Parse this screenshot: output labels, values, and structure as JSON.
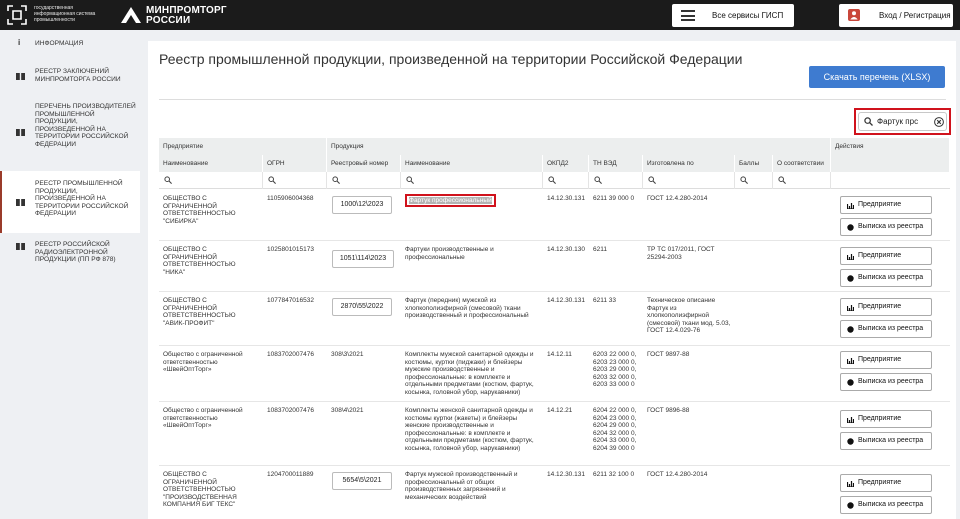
{
  "header": {
    "gisp_text": "государственная информационная система промышленности",
    "ministry_text": "МИНПРОМТОРГ РОССИИ",
    "services_label": "Все сервисы ГИСП",
    "login_label": "Вход / Регистрация"
  },
  "sidebar": {
    "items": [
      {
        "label": "Информация"
      },
      {
        "label": "Реестр заключений Минпромторга России"
      },
      {
        "label": "Перечень производителей промышленной продукции, произведенной на территории Российской Федерации"
      },
      {
        "label": "Реестр промышленной продукции, произведенной на территории Российской Федерации"
      },
      {
        "label": "Реестр российской радиоэлектронной продукции (ПП РФ 878)"
      }
    ]
  },
  "main": {
    "title": "Реестр промышленной продукции, произведенной на территории Российской Федерации",
    "download_label": "Скачать перечень (XLSX)",
    "search": {
      "value": "Фартук прс"
    }
  },
  "table": {
    "group_headers": {
      "enterprise": "Предприятие",
      "product": "Продукция",
      "actions": "Действия"
    },
    "columns": [
      "Наименование",
      "ОГРН",
      "Реестровый номер",
      "Наименование",
      "ОКПД2",
      "ТН ВЭД",
      "Изготовлена по",
      "Баллы",
      "О соответствии"
    ],
    "buttons": {
      "enterprise": "Предприятие",
      "extract": "Выписка из реестра"
    },
    "rows": [
      {
        "company": "ОБЩЕСТВО С ОГРАНИЧЕННОЙ ОТВЕТСТВЕННОСТЬЮ \"СИБИРКА\"",
        "ogrn": "1105906004368",
        "reg": "1000\\12\\2023",
        "product": "Фартук профессиональный",
        "okpd": "14.12.30.131",
        "tnved": "6211 39 000 0",
        "standard": "ГОСТ 12.4.280-2014"
      },
      {
        "company": "ОБЩЕСТВО С ОГРАНИЧЕННОЙ ОТВЕТСТВЕННОСТЬЮ \"НИКА\"",
        "ogrn": "1025801015173",
        "reg": "1051\\114\\2023",
        "product": "Фартуки производственные и профессиональные",
        "okpd": "14.12.30.130",
        "tnved": "6211",
        "standard": "ТР ТС 017/2011, ГОСТ 25294-2003"
      },
      {
        "company": "ОБЩЕСТВО С ОГРАНИЧЕННОЙ ОТВЕТСТВЕННОСТЬЮ \"АВИК-ПРОФИТ\"",
        "ogrn": "1077847016532",
        "reg": "2870\\55\\2022",
        "product": "Фартук (передник) мужской из хлопкополиэфирной (смесовой) ткани производственный и профессиональный",
        "okpd": "14.12.30.131",
        "tnved": "6211 33",
        "standard": "Техническое описание Фартук из хлопкополиэфирной (смесовой) ткани мод. 5.03, ГОСТ 12.4.029-76"
      },
      {
        "company": "Общество с ограниченной ответственностью «ШвейОптТорг»",
        "ogrn": "1083702007476",
        "reg": "308\\3\\2021",
        "product": "Комплекты мужской санитарной одежды и костюмы, куртки (пиджаки) и блейзеры мужские производственные и профессиональные: в комплекте и отдельными предметами (костюм, фартук, косынка, головной убор, нарукавники)",
        "okpd": "14.12.11",
        "tnved": "6203 22 000 0, 6203 23 000 0, 6203 29 000 0, 6203 32 000 0, 6203 33 000 0",
        "standard": "ГОСТ 9897-88"
      },
      {
        "company": "Общество с ограниченной ответственностью «ШвейОптТорг»",
        "ogrn": "1083702007476",
        "reg": "308\\4\\2021",
        "product": "Комплекты женской санитарной одежды и костюмы куртки (жакеты) и блейзеры женские производственные и профессиональные: в комплекте и отдельными предметами (костюм, фартук, косынка, головной убор, нарукавники)",
        "okpd": "14.12.21",
        "tnved": "6204 22 000 0, 6204 23 000 0, 6204 29 000 0, 6204 32 000 0, 6204 33 000 0, 6204 39 000 0",
        "standard": "ГОСТ 9896-88"
      },
      {
        "company": "ОБЩЕСТВО С ОГРАНИЧЕННОЙ ОТВЕТСТВЕННОСТЬЮ \"ПРОИЗВОДСТВЕННАЯ КОМПАНИЯ БИГ ТЕКС\"",
        "ogrn": "1204700011889",
        "reg": "5654\\5\\2021",
        "product": "Фартук мужской производственный и профессиональный от общих производственных загрязнений и механических воздействий",
        "okpd": "14.12.30.131",
        "tnved": "6211 32 100 0",
        "standard": "ГОСТ 12.4.280-2014"
      }
    ]
  }
}
